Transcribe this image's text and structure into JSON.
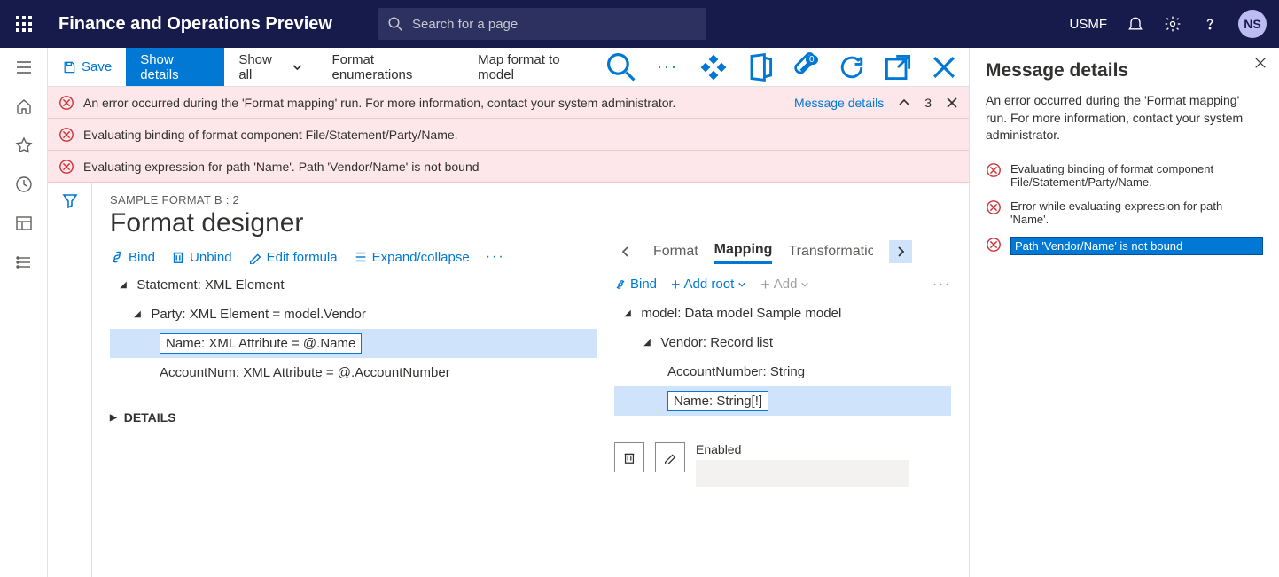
{
  "topnav": {
    "brand": "Finance and Operations Preview",
    "search_placeholder": "Search for a page",
    "company": "USMF",
    "avatar": "NS"
  },
  "cmdbar": {
    "save": "Save",
    "show_details": "Show details",
    "show_all": "Show all",
    "format_enum": "Format enumerations",
    "map_format": "Map format to model",
    "attach_count": "0"
  },
  "banners": [
    "An error occurred during the 'Format mapping' run. For more information, contact your system administrator.",
    "Evaluating binding of format component File/Statement/Party/Name.",
    "Evaluating expression for path 'Name'.   Path 'Vendor/Name' is not bound"
  ],
  "banner_right": {
    "message_details": "Message details",
    "count": "3"
  },
  "page": {
    "crumb": "SAMPLE FORMAT B : 2",
    "title": "Format designer"
  },
  "toolbar": {
    "bind": "Bind",
    "unbind": "Unbind",
    "edit_formula": "Edit formula",
    "expand": "Expand/collapse"
  },
  "left_tree": {
    "n1": "Statement: XML Element",
    "n2": "Party: XML Element = model.Vendor",
    "n3": "Name: XML Attribute = @.Name",
    "n4": "AccountNum: XML Attribute = @.AccountNumber"
  },
  "tabs": {
    "format": "Format",
    "mapping": "Mapping",
    "transform": "Transformations"
  },
  "paneactions": {
    "bind": "Bind",
    "add_root": "Add root",
    "add": "Add"
  },
  "right_tree": {
    "n1": "model: Data model Sample model",
    "n2": "Vendor: Record list",
    "n3": "AccountNumber: String",
    "n4": "Name: String[!]"
  },
  "props": {
    "enabled": "Enabled"
  },
  "details": "DETAILS",
  "sidepanel": {
    "title": "Message details",
    "desc": "An error occurred during the 'Format mapping' run. For more information, contact your system administrator.",
    "items": [
      "Evaluating binding of format component File/Statement/Party/Name.",
      "Error while evaluating expression for path 'Name'.",
      "Path 'Vendor/Name' is not bound"
    ]
  }
}
